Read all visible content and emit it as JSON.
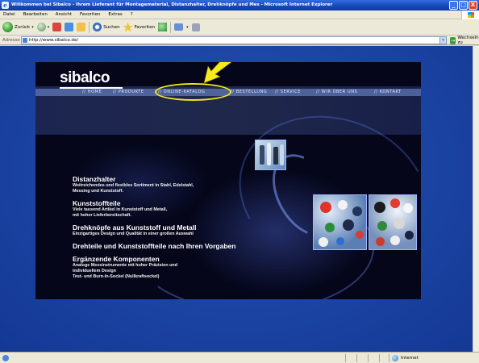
{
  "window": {
    "title": "Willkommen bei Sibalco - Ihrem Lieferant für Montagematerial, Distanzhalter, Drehknöpfe und Mes - Microsoft Internet Explorer",
    "minimize": "_",
    "maximize": "□",
    "close": "X"
  },
  "menubar": {
    "items": [
      "Datei",
      "Bearbeiten",
      "Ansicht",
      "Favoriten",
      "Extras",
      "?"
    ]
  },
  "toolbar": {
    "back_label": "Zurück",
    "search_label": "Suchen",
    "favorites_label": "Favoriten"
  },
  "address": {
    "label": "Adresse",
    "url": "http://www.sibalco.de/",
    "go_label": "Wechseln zu"
  },
  "site": {
    "logo": "sibalco",
    "nav": [
      "// HOME",
      "// PRODUKTE",
      "// ONLINE-KATALOG",
      "// BESTELLUNG",
      "// SERVICE",
      "// WIR ÜBER UNS",
      "// KONTAKT"
    ],
    "highlight_color": "#f5ea1a",
    "content": [
      {
        "title": "Distanzhalter",
        "desc": "Weitreichendes und flexibles Sortiment in Stahl, Edelstahl,\nMessing und Kunststoff."
      },
      {
        "title": "Kunststoffteile",
        "desc": "Viele tausend Artikel in Kunststoff und Metall,\nmit hoher Lieferbereitschaft."
      },
      {
        "title": "Drehknöpfe aus Kunststoff und Metall",
        "desc": "Einzigartiges Design und Qualität in einer großen Auswahl"
      },
      {
        "title": "Drehteile und Kunststoffteile nach Ihren Vorgaben",
        "desc": ""
      },
      {
        "title": "Ergänzende Komponenten",
        "desc": "Analoge Messinstrumente mit hoher Präzision und\nindividuellem Design\nTest- und Burn-In-Sockel (Nullkraftsockel)"
      }
    ]
  },
  "statusbar": {
    "zone": "Internet"
  },
  "colors": {
    "page_bg": "#1c45a4",
    "site_bg": "#05061a",
    "arrow": "#f5ea1a"
  }
}
